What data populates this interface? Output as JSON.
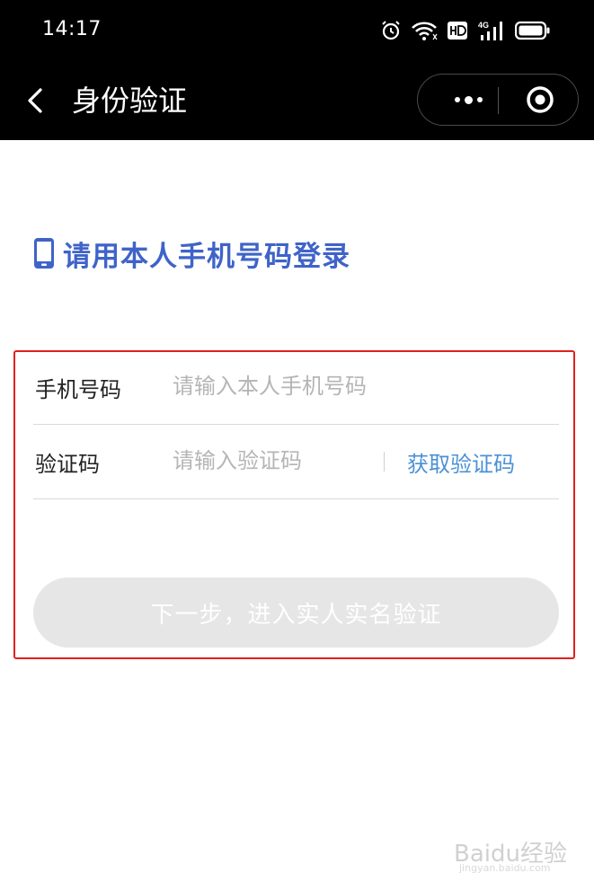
{
  "status_bar": {
    "time": "14:17",
    "network_label": "4G"
  },
  "nav": {
    "title": "身份验证"
  },
  "heading": {
    "text": "请用本人手机号码登录"
  },
  "form": {
    "phone": {
      "label": "手机号码",
      "placeholder": "请输入本人手机号码",
      "value": ""
    },
    "code": {
      "label": "验证码",
      "placeholder": "请输入验证码",
      "value": "",
      "get_code": "获取验证码"
    },
    "submit_label": "下一步，进入实人实名验证"
  },
  "watermark": {
    "brand": "Baidu经验",
    "url": "jingyan.baidu.com"
  },
  "colors": {
    "accent_blue": "#3f63c8",
    "link_blue": "#4b90d6",
    "highlight_red": "#e0201c",
    "disabled_button": "#e6e6e6"
  },
  "icons": [
    "alarm-icon",
    "wifi-icon",
    "hd-icon",
    "signal-icon",
    "battery-icon",
    "back-arrow-icon",
    "more-dots-icon",
    "target-icon",
    "phone-icon"
  ]
}
